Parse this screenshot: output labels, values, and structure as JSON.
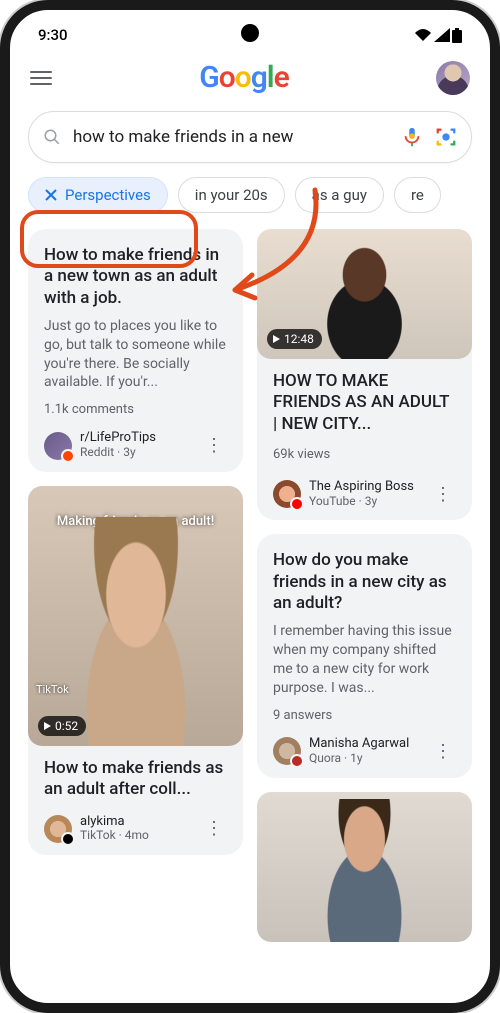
{
  "status": {
    "time": "9:30"
  },
  "logo": {
    "letters": [
      "G",
      "o",
      "o",
      "g",
      "l",
      "e"
    ]
  },
  "search": {
    "query": "how to make friends in a new"
  },
  "chips": [
    {
      "label": "Perspectives",
      "active": true
    },
    {
      "label": "in your 20s",
      "active": false
    },
    {
      "label": "as a guy",
      "active": false
    },
    {
      "label": "re",
      "active": false
    }
  ],
  "col_left": [
    {
      "title": "How to make friends in a new town as an adult with a job.",
      "snippet": "Just go to places you like to go, but talk to someone while you're there. Be socially available. If you'r...",
      "stat": "1.1k comments",
      "source_name": "r/LifeProTips",
      "source_meta": "Reddit · 3y"
    },
    {
      "is_video": true,
      "duration": "0:52",
      "caption": "Making friends as an adult!",
      "tiktok": "TikTok",
      "title": "How to make friends as an adult after coll...",
      "source_name": "alykima",
      "source_meta": "TikTok · 4mo"
    }
  ],
  "col_right": [
    {
      "is_video": true,
      "duration": "12:48",
      "title": "HOW TO MAKE FRIENDS AS AN ADULT | NEW CITY...",
      "stat": "69k views",
      "source_name": "The Aspiring Boss",
      "source_meta": "YouTube · 3y"
    },
    {
      "title": "How do you make friends in a new city as an adult?",
      "snippet": "I remember having this issue when my company shifted me to a new city for work purpose. I was...",
      "stat": "9 answers",
      "source_name": "Manisha Agarwal",
      "source_meta": "Quora · 1y"
    },
    {
      "is_video_only": true
    }
  ]
}
